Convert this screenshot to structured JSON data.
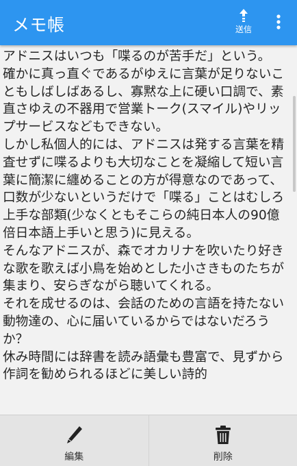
{
  "appbar": {
    "title": "メモ帳",
    "send_label": "送信",
    "accent_color": "#2d95f0"
  },
  "memo": {
    "text": "アドニスはいつも「喋るのが苦手だ」という。\n確かに真っ直ぐであるがゆえに言葉が足りないこともしばしばあるし、寡黙な上に硬い口調で、素直さゆえの不器用で営業トーク(スマイル)やリップサービスなどもできない。\nしかし私個人的には、アドニスは発する言葉を精査せずに喋るよりも大切なことを凝縮して短い言葉に簡潔に纏めることの方が得意なのであって、口数が少ないというだけで「喋る」ことはむしろ上手な部類(少なくともそこらの純日本人の90億倍日本語上手いと思う)に見える。\nそんなアドニスが、森でオカリナを吹いたり好きな歌を歌えば小鳥を始めとした小さきものたちが集まり、安らぎながら聴いてくれる。\nそれを成せるのは、会話のための言語を持たない動物達の、心に届いているからではないだろうか？\n休み時間には辞書を読み語彙も豊富で、見ずから作詞を勧められるほどに美しい詩的"
  },
  "bottom_bar": {
    "edit_label": "編集",
    "delete_label": "削除"
  },
  "icons": {
    "send": "upload-arrow-icon",
    "overflow": "more-vertical-icon",
    "edit": "pencil-icon",
    "delete": "trash-icon"
  }
}
